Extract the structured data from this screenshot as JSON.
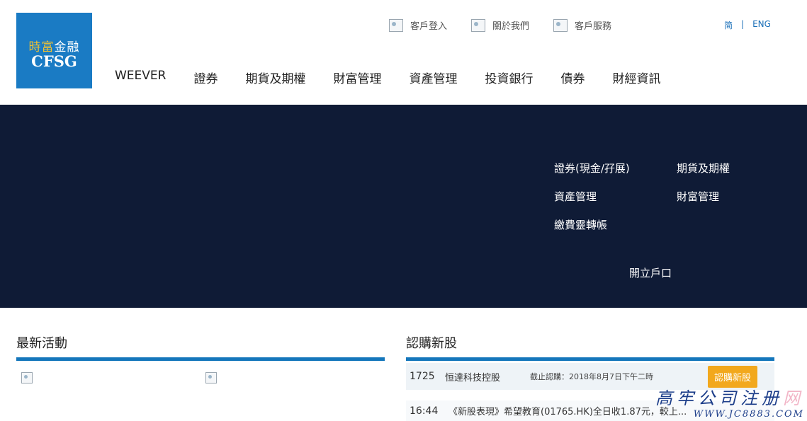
{
  "logo": {
    "chinese_left": "時富",
    "chinese_right": "金融",
    "english": "CFSG"
  },
  "top_links": [
    {
      "label": "客戶登入"
    },
    {
      "label": "關於我們"
    },
    {
      "label": "客戶服務"
    }
  ],
  "language": {
    "simplified": "简",
    "separator": "|",
    "english": "ENG"
  },
  "main_nav": [
    {
      "label": "WEEVER"
    },
    {
      "label": "證券"
    },
    {
      "label": "期貨及期權"
    },
    {
      "label": "財富管理"
    },
    {
      "label": "資產管理"
    },
    {
      "label": "投資銀行"
    },
    {
      "label": "債券"
    },
    {
      "label": "財經資訊"
    }
  ],
  "banner": {
    "quick_links": [
      {
        "label": "證券(現金/孖展)"
      },
      {
        "label": "期貨及期權"
      },
      {
        "label": "資產管理"
      },
      {
        "label": "財富管理"
      },
      {
        "label": "繳費靈轉帳"
      }
    ],
    "open_account": "開立戶口"
  },
  "latest_events": {
    "title": "最新活動"
  },
  "ipo": {
    "title": "認購新股",
    "row": {
      "code": "1725",
      "name": "恒達科技控股",
      "deadline": "截止認購：2018年8月7日下午二時",
      "button": "認購新股"
    },
    "news": {
      "time": "16:44",
      "headline": "《新股表現》希望教育(01765.HK)全日收1.87元，較上..."
    }
  },
  "watermark": {
    "text": "高牢公司注册",
    "bg_text": "网",
    "url": "WWW.JC8883.COM"
  },
  "colors": {
    "brand_blue": "#1a7bc4",
    "banner_navy": "#0f1b36",
    "section_bar": "#1476bb",
    "ipo_button": "#f2a81d"
  }
}
